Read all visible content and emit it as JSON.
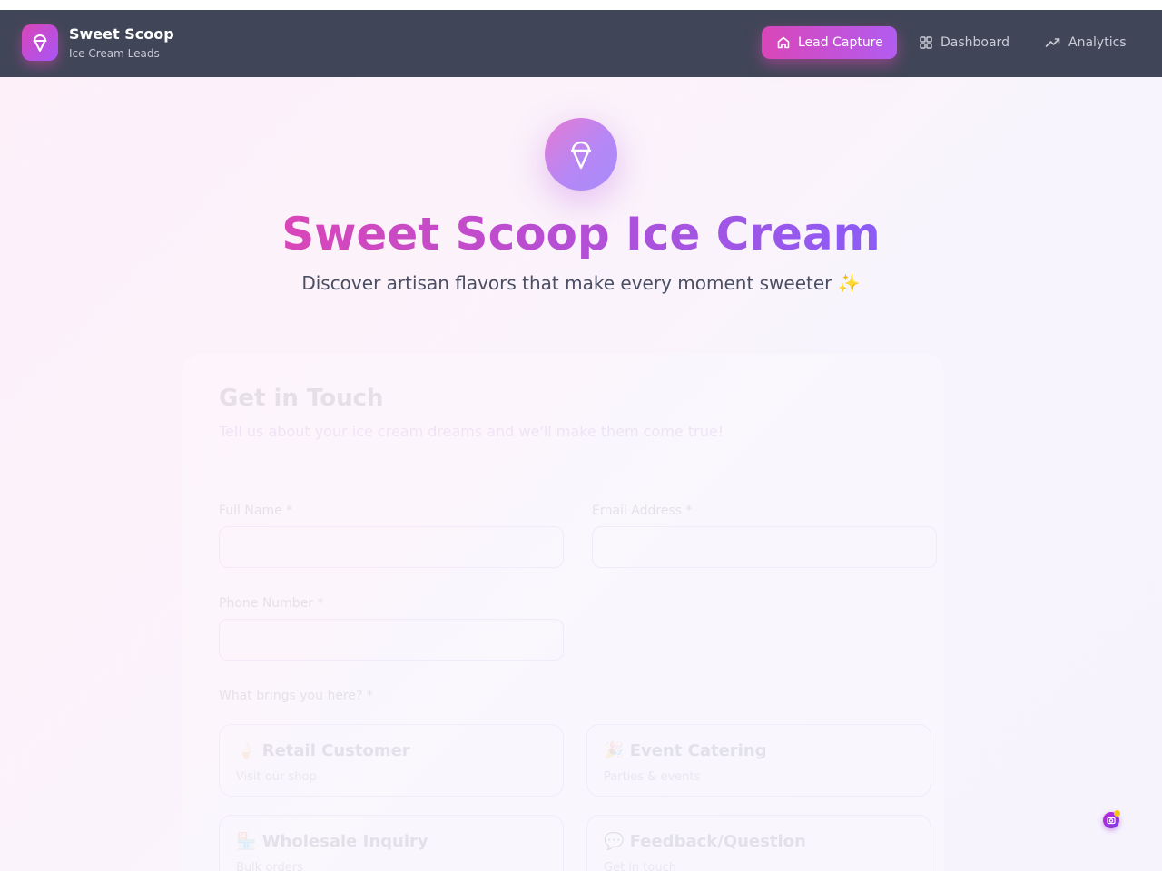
{
  "brand": {
    "name": "Sweet Scoop",
    "subtitle": "Ice Cream Leads",
    "logo_icon": "ice-cream-icon"
  },
  "nav": {
    "items": [
      {
        "label": "Lead Capture",
        "icon": "home-icon",
        "active": true
      },
      {
        "label": "Dashboard",
        "icon": "grid-icon",
        "active": false
      },
      {
        "label": "Analytics",
        "icon": "trending-up-icon",
        "active": false
      }
    ]
  },
  "hero": {
    "icon": "ice-cream-icon",
    "title": "Sweet Scoop Ice Cream",
    "subtitle": "Discover artisan flavors that make every moment sweeter",
    "sparkle": "✨"
  },
  "form": {
    "title": "Get in Touch",
    "subtitle": "Tell us about your ice cream dreams and we'll make them come true!",
    "full_name_label": "Full Name *",
    "email_label": "Email Address *",
    "phone_label": "Phone Number *",
    "reason_label": "What brings you here? *",
    "options": [
      {
        "title": "Retail Customer",
        "sub": "Visit our shop",
        "emoji": "🍦"
      },
      {
        "title": "Event Catering",
        "sub": "Parties & events",
        "emoji": "🎉"
      },
      {
        "title": "Wholesale Inquiry",
        "sub": "Bulk orders",
        "emoji": "🏪"
      },
      {
        "title": "Feedback/Question",
        "sub": "Get in touch",
        "emoji": "💬"
      }
    ]
  },
  "colors": {
    "navbar": "#404657",
    "accent_pink": "#d946b8",
    "accent_purple": "#8b5cf6"
  }
}
